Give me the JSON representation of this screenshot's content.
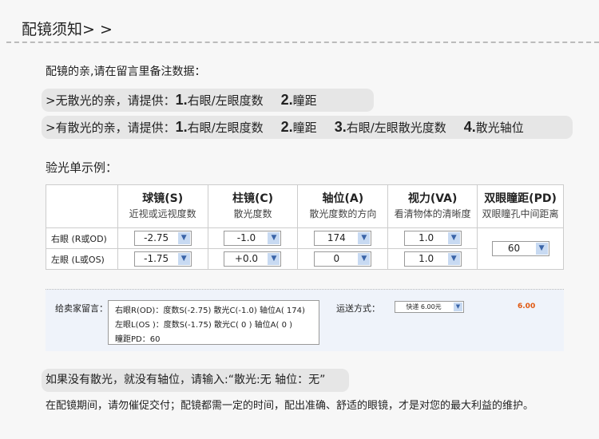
{
  "title": "配镜须知> >",
  "intro": "配镜的亲,请在留言里备注数据：",
  "no_astig": {
    "prefix": ">无散光的亲，请提供：",
    "items": [
      {
        "n": "1.",
        "t": "右眼/左眼度数"
      },
      {
        "n": "2.",
        "t": "瞳距"
      }
    ]
  },
  "astig": {
    "prefix": ">有散光的亲，请提供：",
    "items": [
      {
        "n": "1.",
        "t": "右眼/左眼度数"
      },
      {
        "n": "2.",
        "t": "瞳距"
      },
      {
        "n": "3.",
        "t": "右眼/左眼散光度数"
      },
      {
        "n": "4.",
        "t": "散光轴位"
      }
    ]
  },
  "example_label": "验光单示例：",
  "table": {
    "headers": [
      {
        "title": "球镜(S)",
        "sub": "近视或远视度数"
      },
      {
        "title": "柱镜(C)",
        "sub": "散光度数"
      },
      {
        "title": "轴位(A)",
        "sub": "散光度数的方向"
      },
      {
        "title": "视力(VA)",
        "sub": "看清物体的清晰度"
      },
      {
        "title": "双眼瞳距(PD)",
        "sub": "双眼瞳孔中间距离"
      }
    ],
    "rows": [
      {
        "label": "右眼 (R或OD)",
        "values": [
          "-2.75",
          "-1.0",
          "174",
          "1.0"
        ]
      },
      {
        "label": "左眼 (L或OS)",
        "values": [
          "-1.75",
          "+0.0",
          "0",
          "1.0"
        ]
      }
    ],
    "pd": "60"
  },
  "form": {
    "message_label": "给卖家留言：",
    "message_lines": [
      "右眼R(OD)：度数S(-2.75)   散光C(-1.0)   轴位A( 174)",
      "左眼L(OS )：度数S(-1.75)   散光C( 0 )     轴位A( 0 )",
      "瞳距PD：60"
    ],
    "shipping_label": "运送方式：",
    "shipping_value": "快递 6.00元",
    "fee": "6.00"
  },
  "note": "如果没有散光，就没有轴位，请输入:“散光:无    轴位：无”",
  "footer": "在配镜期间，请勿催促交付；配镜都需一定的时间，配出准确、舒适的眼镜，才是对您的最大利益的维护。"
}
